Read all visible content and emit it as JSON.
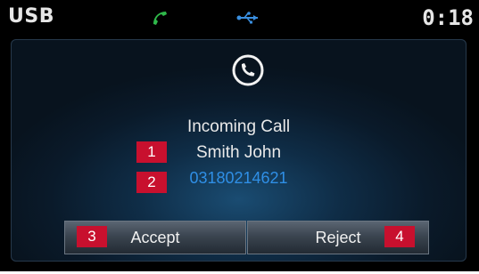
{
  "status_bar": {
    "source": "USB",
    "time": "0:18",
    "icons": [
      "phone-handset-icon",
      "usb-icon"
    ],
    "phone_icon_color": "#2fb84a",
    "usb_icon_color": "#3a8fe0"
  },
  "call": {
    "title": "Incoming Call",
    "caller_name": "Smith John",
    "caller_number": "03180214621",
    "icon": "phone-circle-icon",
    "number_color": "#2f8fe6"
  },
  "buttons": {
    "accept_label": "Accept",
    "reject_label": "Reject"
  },
  "markers": [
    "1",
    "2",
    "3",
    "4"
  ],
  "marker_color": "#c8102e"
}
